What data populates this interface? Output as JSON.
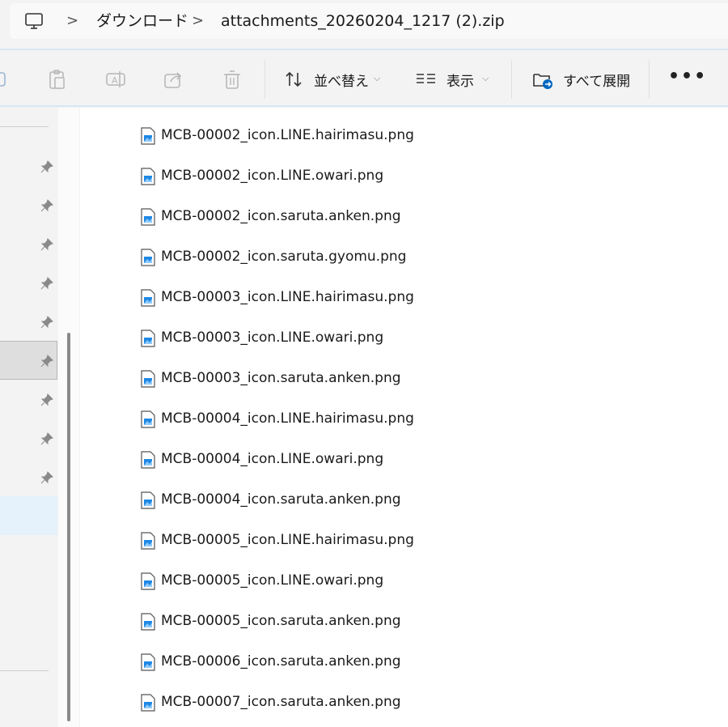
{
  "address": {
    "crumbs": [
      "ダウンロード",
      "attachments_20260204_1217 (2).zip"
    ],
    "separator": ">"
  },
  "toolbar": {
    "sort_label": "並べ替え",
    "view_label": "表示",
    "extract_label": "すべて展開",
    "more_label": "•••"
  },
  "files": [
    "MCB-00002_icon.LINE.hairimasu.png",
    "MCB-00002_icon.LINE.owari.png",
    "MCB-00002_icon.saruta.anken.png",
    "MCB-00002_icon.saruta.gyomu.png",
    "MCB-00003_icon.LINE.hairimasu.png",
    "MCB-00003_icon.LINE.owari.png",
    "MCB-00003_icon.saruta.anken.png",
    "MCB-00004_icon.LINE.hairimasu.png",
    "MCB-00004_icon.LINE.owari.png",
    "MCB-00004_icon.saruta.anken.png",
    "MCB-00005_icon.LINE.hairimasu.png",
    "MCB-00005_icon.LINE.owari.png",
    "MCB-00005_icon.saruta.anken.png",
    "MCB-00006_icon.saruta.anken.png",
    "MCB-00007_icon.saruta.anken.png"
  ],
  "colors": {
    "accent": "#0067c0",
    "selection": "#dedede",
    "hover": "#e5f1fb"
  }
}
